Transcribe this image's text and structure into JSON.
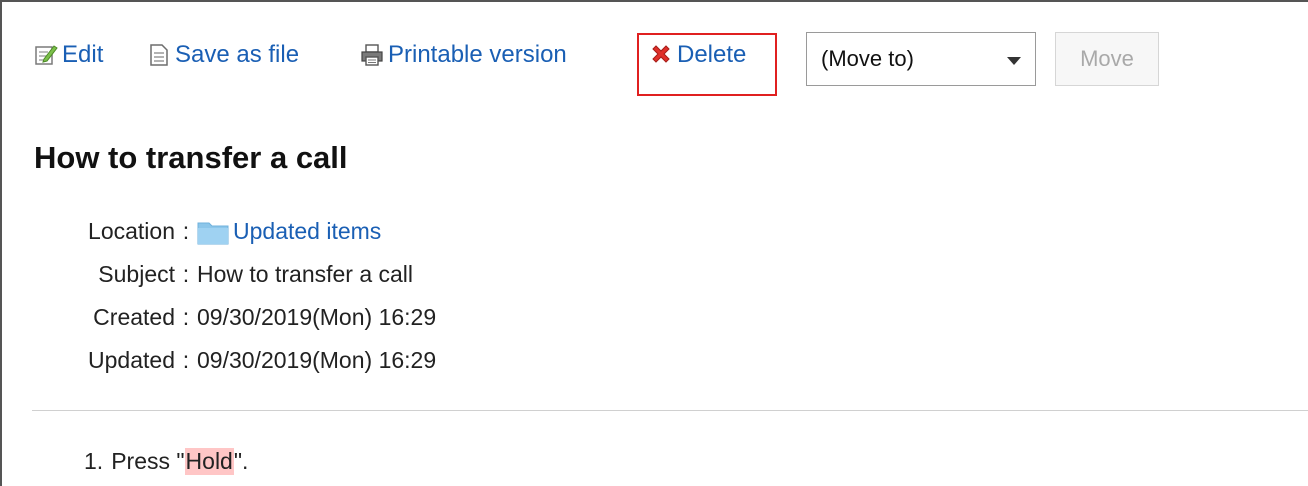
{
  "toolbar": {
    "edit_label": "Edit",
    "save_label": "Save as file",
    "print_label": "Printable version",
    "delete_label": "Delete",
    "move_select_value": "(Move to)",
    "move_button_label": "Move"
  },
  "article": {
    "title": "How to transfer a call",
    "meta": {
      "location_label": "Location",
      "location_value": "Updated items",
      "subject_label": "Subject",
      "subject_value": "How to transfer a call",
      "created_label": "Created",
      "created_value": "09/30/2019(Mon) 16:29",
      "updated_label": "Updated",
      "updated_value": "09/30/2019(Mon) 16:29",
      "separator": ":"
    },
    "body": {
      "step1_number": "1.",
      "step1_prefix": "Press \"",
      "step1_highlight": "Hold",
      "step1_suffix": "\"."
    }
  },
  "colors": {
    "link": "#1a5fb4",
    "highlight_box": "#e02020",
    "text_highlight": "#ffc6c6"
  },
  "icons": {
    "edit": "edit-icon",
    "save": "document-icon",
    "print": "printer-icon",
    "delete": "red-x-icon",
    "folder": "folder-icon"
  }
}
